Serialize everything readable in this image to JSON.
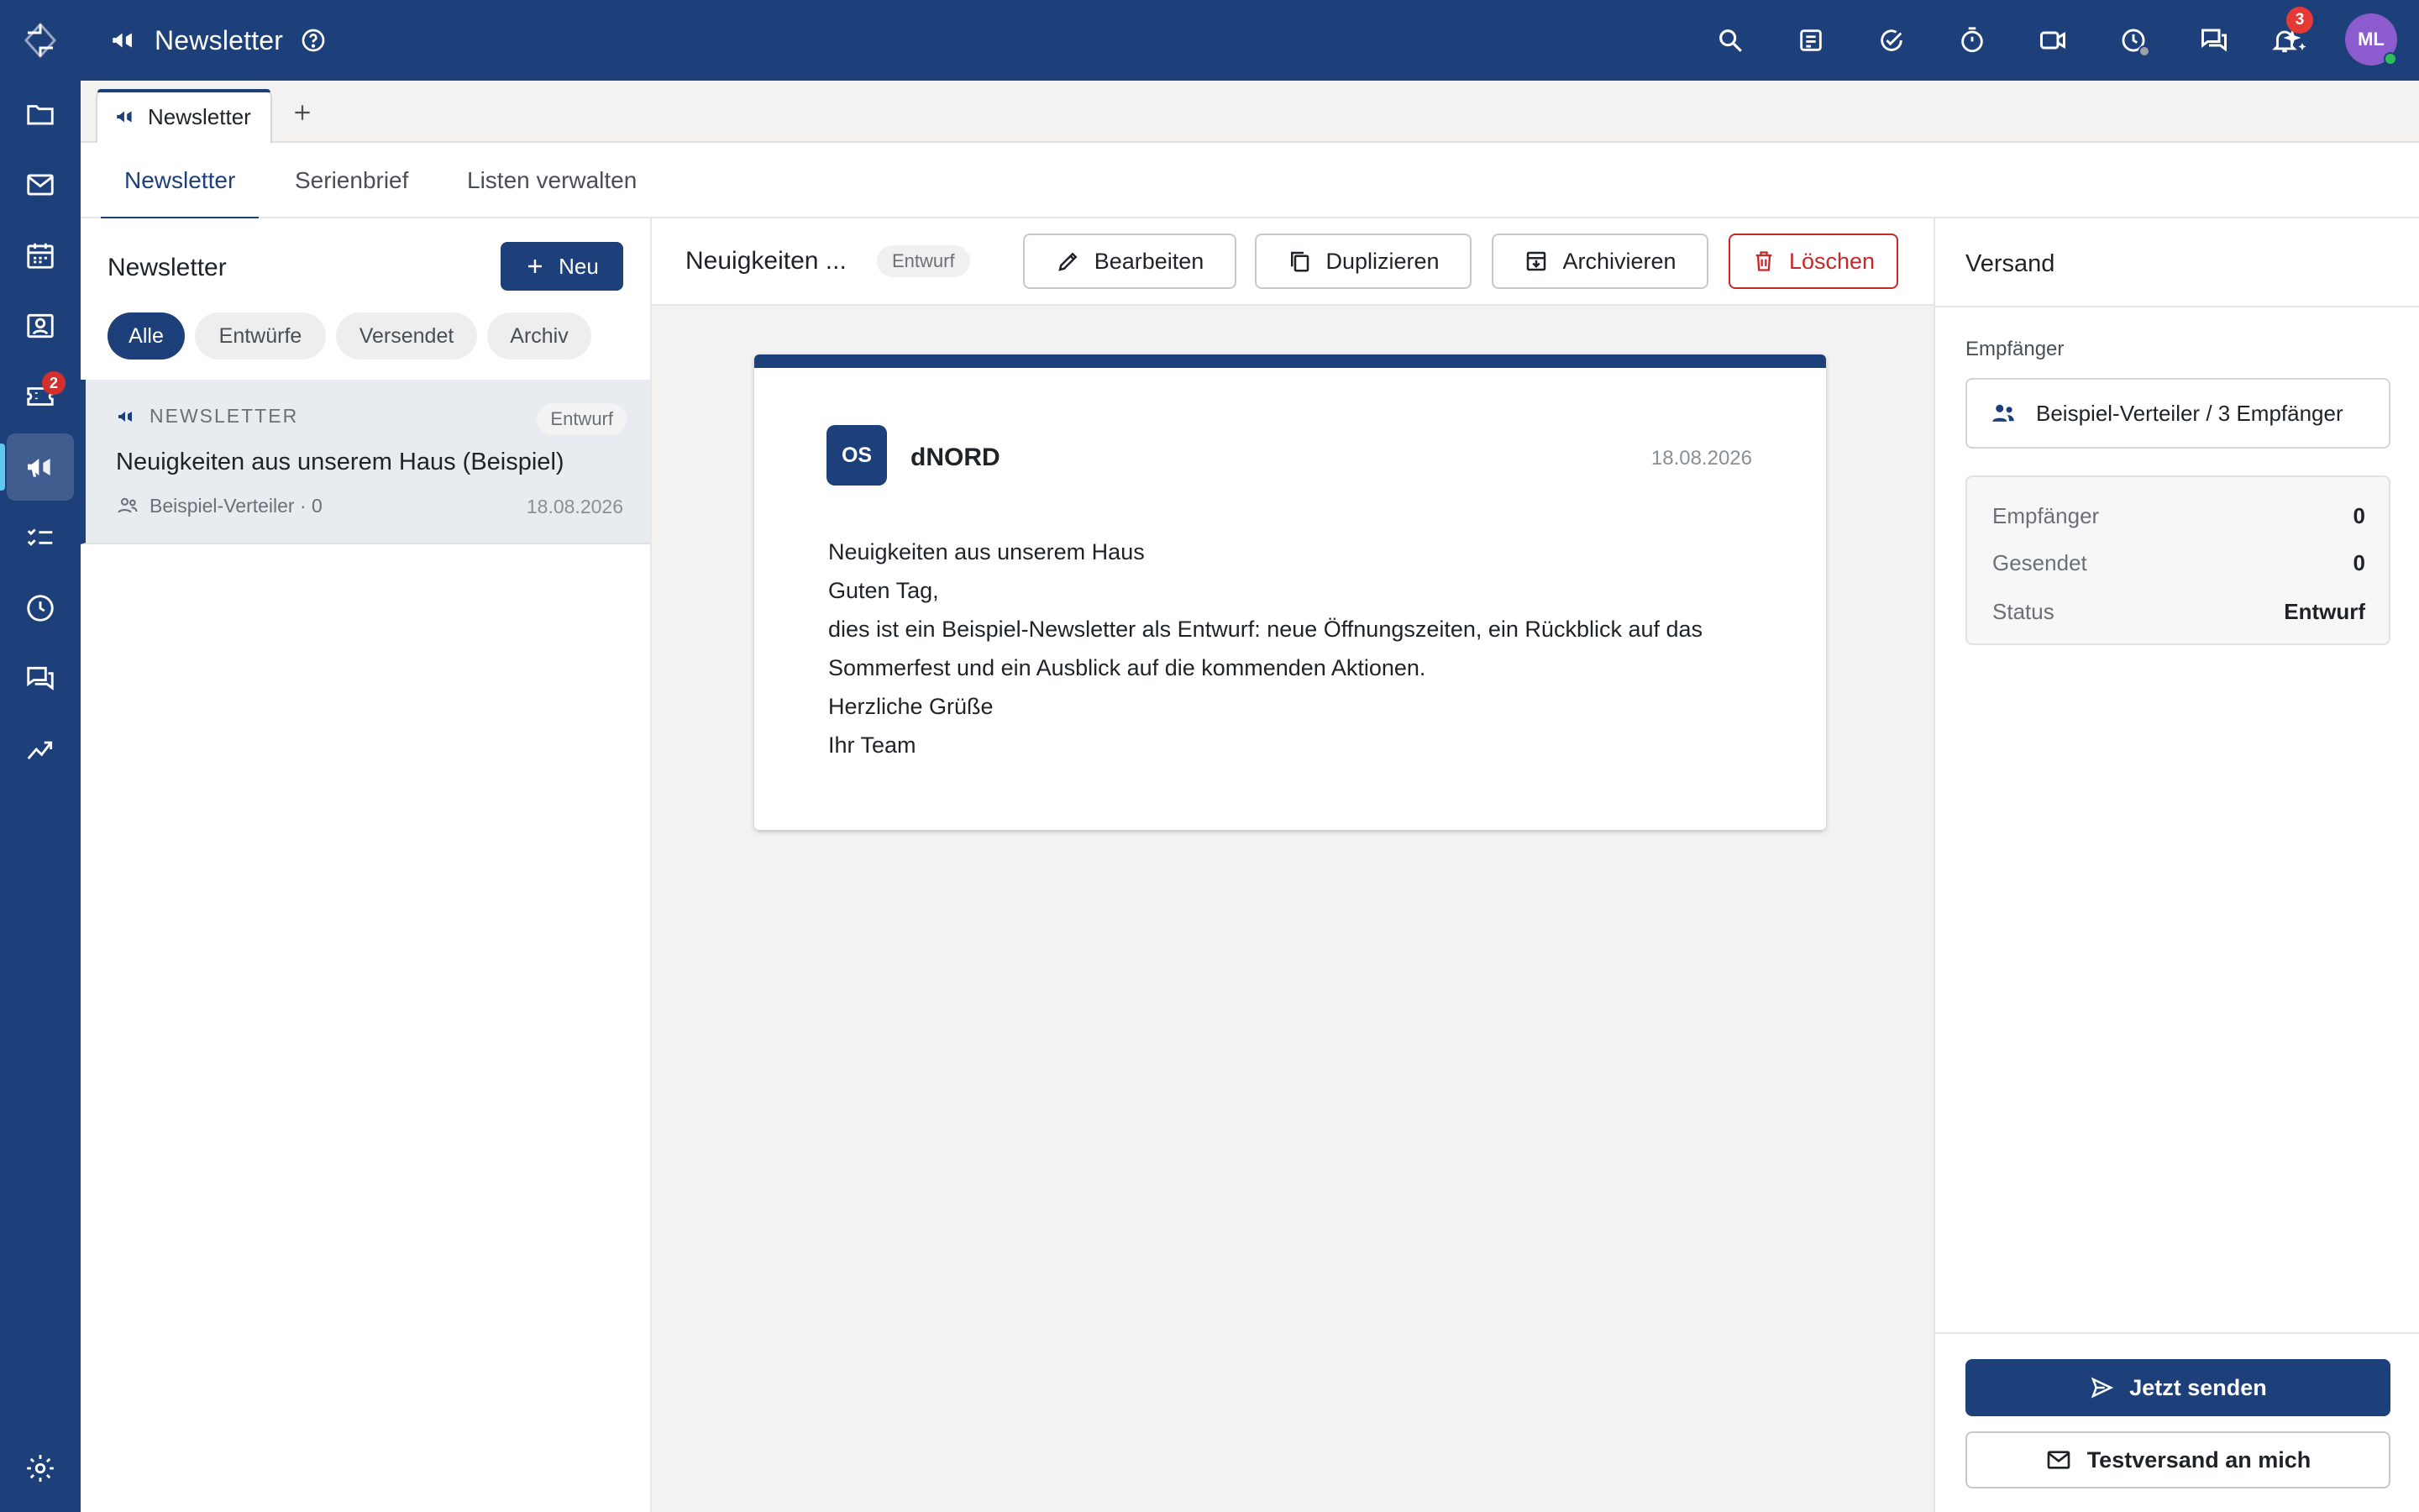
{
  "app": {
    "title": "Newsletter",
    "notification_count": "3",
    "avatar_initials": "ML",
    "accent_color": "#1d3f7a",
    "danger_color": "#c62828"
  },
  "rail": {
    "items": [
      {
        "name": "logo",
        "icon": "app-logo-icon"
      },
      {
        "name": "files",
        "icon": "folder-icon"
      },
      {
        "name": "mail",
        "icon": "mail-icon"
      },
      {
        "name": "calendar",
        "icon": "calendar-icon"
      },
      {
        "name": "contacts",
        "icon": "contact-card-icon"
      },
      {
        "name": "tickets",
        "icon": "ticket-icon",
        "badge": "2"
      },
      {
        "name": "newsletter",
        "icon": "megaphone-icon",
        "active": true
      },
      {
        "name": "tasks",
        "icon": "checklist-icon"
      },
      {
        "name": "time",
        "icon": "clock-icon"
      },
      {
        "name": "chat",
        "icon": "chat-icon"
      },
      {
        "name": "analytics",
        "icon": "trend-icon"
      },
      {
        "name": "settings",
        "icon": "gear-icon"
      }
    ]
  },
  "topbar_icons": [
    "search-icon",
    "note-icon",
    "task-check-icon",
    "timer-icon",
    "video-icon",
    "history-icon",
    "chat-icon",
    "sparkle-icon",
    "bell-icon"
  ],
  "doc_tab": {
    "label": "Newsletter"
  },
  "subtabs": [
    "Newsletter",
    "Serienbrief",
    "Listen verwalten"
  ],
  "list": {
    "title": "Newsletter",
    "new_label": "Neu",
    "filters": [
      "Alle",
      "Entwürfe",
      "Versendet",
      "Archiv"
    ],
    "items": [
      {
        "kind": "NEWSLETTER",
        "status": "Entwurf",
        "title": "Neuigkeiten aus unserem Haus (Beispiel)",
        "meta": "Beispiel-Verteiler · 0",
        "date": "18.08.2026"
      }
    ]
  },
  "detail": {
    "title": "Neuigkeiten ...",
    "status": "Entwurf",
    "actions": {
      "edit": "Bearbeiten",
      "duplicate": "Duplizieren",
      "archive": "Archivieren",
      "delete": "Löschen"
    },
    "preview": {
      "logo_text": "OS",
      "sender": "dNORD",
      "date": "18.08.2026",
      "lines": [
        "Neuigkeiten aus unserem Haus",
        "Guten Tag,",
        "dies ist ein Beispiel-Newsletter als Entwurf: neue Öffnungszeiten, ein Rückblick auf das Sommerfest und ein Ausblick auf die kommenden Aktionen.",
        "Herzliche Grüße",
        "Ihr Team"
      ]
    }
  },
  "send_panel": {
    "title": "Versand",
    "recipients_label": "Empfänger",
    "recipients_value": "Beispiel-Verteiler / 3 Empfänger",
    "stats": [
      {
        "label": "Empfänger",
        "value": "0"
      },
      {
        "label": "Gesendet",
        "value": "0"
      },
      {
        "label": "Status",
        "value": "Entwurf"
      }
    ],
    "send_now": "Jetzt senden",
    "test_send": "Testversand an mich"
  }
}
